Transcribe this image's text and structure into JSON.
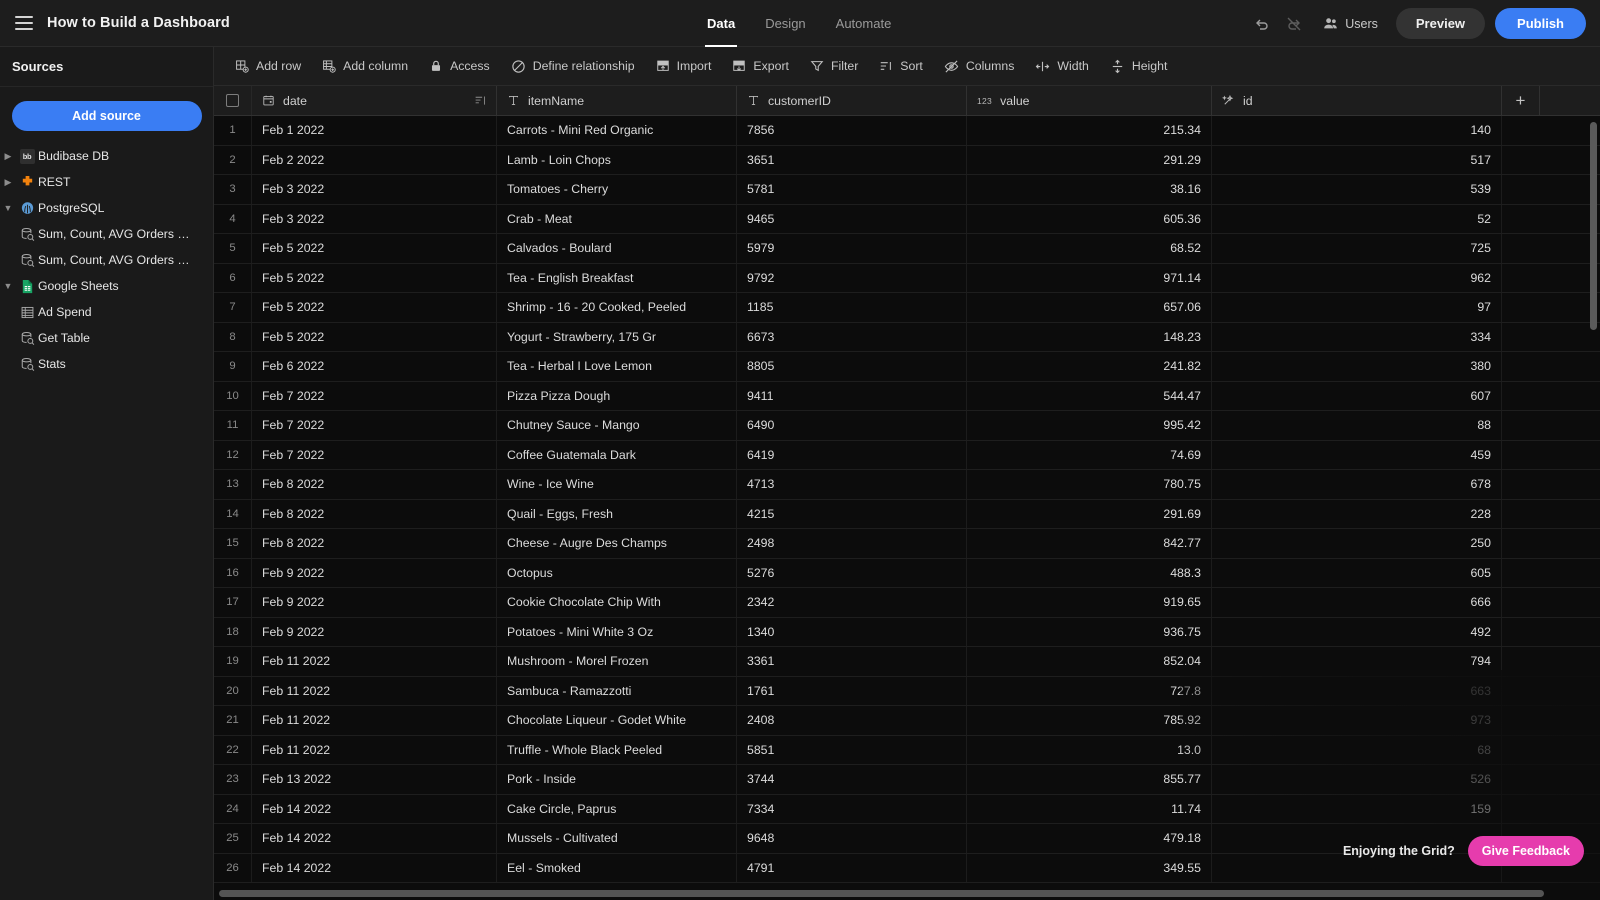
{
  "header": {
    "menu_icon": "hamburger-icon",
    "title": "How to Build a Dashboard",
    "tabs": [
      {
        "label": "Data",
        "active": true
      },
      {
        "label": "Design",
        "active": false
      },
      {
        "label": "Automate",
        "active": false
      }
    ],
    "undo_icon": "undo-icon",
    "redo_icon": "redo-icon",
    "users_icon": "users-icon",
    "users_label": "Users",
    "preview_label": "Preview",
    "publish_label": "Publish",
    "publish_color": "#3a7df3"
  },
  "sidebar": {
    "title": "Sources",
    "add_source_label": "Add source",
    "items": [
      {
        "label": "Budibase DB",
        "icon": "budibase-db-icon",
        "level": 0,
        "expanded": false,
        "chevron": "chevron-right-icon"
      },
      {
        "label": "REST",
        "icon": "rest-icon",
        "level": 0,
        "expanded": false,
        "chevron": "chevron-right-icon"
      },
      {
        "label": "PostgreSQL",
        "icon": "postgresql-icon",
        "level": 0,
        "expanded": true,
        "chevron": "chevron-down-icon"
      },
      {
        "label": "Sum, Count, AVG Orders By Date",
        "icon": "query-icon",
        "level": 1
      },
      {
        "label": "Sum, Count, AVG Orders By Dat…",
        "icon": "query-icon",
        "level": 1
      },
      {
        "label": "Google Sheets",
        "icon": "google-sheets-icon",
        "level": 0,
        "expanded": true,
        "chevron": "chevron-down-icon"
      },
      {
        "label": "Ad Spend",
        "icon": "table-icon",
        "level": 1
      },
      {
        "label": "Get Table",
        "icon": "query-icon",
        "level": 1
      },
      {
        "label": "Stats",
        "icon": "query-icon",
        "level": 1
      }
    ]
  },
  "toolbar": {
    "items": [
      {
        "label": "Add row",
        "icon": "add-row-icon"
      },
      {
        "label": "Add column",
        "icon": "add-column-icon"
      },
      {
        "label": "Access",
        "icon": "lock-icon"
      },
      {
        "label": "Define relationship",
        "icon": "relationship-icon"
      },
      {
        "label": "Import",
        "icon": "import-icon"
      },
      {
        "label": "Export",
        "icon": "export-icon"
      },
      {
        "label": "Filter",
        "icon": "filter-icon"
      },
      {
        "label": "Sort",
        "icon": "sort-icon"
      },
      {
        "label": "Columns",
        "icon": "hide-columns-icon"
      },
      {
        "label": "Width",
        "icon": "width-icon"
      },
      {
        "label": "Height",
        "icon": "height-icon"
      }
    ]
  },
  "grid": {
    "select_all_icon": "checkbox-icon",
    "add_column_icon": "plus-icon",
    "columns": [
      {
        "name": "date",
        "type_icon": "calendar-icon",
        "sorted": true,
        "sort_icon": "sort-descending-icon"
      },
      {
        "name": "itemName",
        "type_icon": "text-icon"
      },
      {
        "name": "customerID",
        "type_icon": "text-icon"
      },
      {
        "name": "value",
        "type_icon": "number-icon"
      },
      {
        "name": "id",
        "type_icon": "formula-icon"
      }
    ],
    "rows": [
      {
        "n": "1",
        "date": "Feb 1 2022",
        "itemName": "Carrots - Mini Red Organic",
        "customerID": "7856",
        "value": "215.34",
        "id": "140"
      },
      {
        "n": "2",
        "date": "Feb 2 2022",
        "itemName": "Lamb - Loin Chops",
        "customerID": "3651",
        "value": "291.29",
        "id": "517"
      },
      {
        "n": "3",
        "date": "Feb 3 2022",
        "itemName": "Tomatoes - Cherry",
        "customerID": "5781",
        "value": "38.16",
        "id": "539"
      },
      {
        "n": "4",
        "date": "Feb 3 2022",
        "itemName": "Crab - Meat",
        "customerID": "9465",
        "value": "605.36",
        "id": "52"
      },
      {
        "n": "5",
        "date": "Feb 5 2022",
        "itemName": "Calvados - Boulard",
        "customerID": "5979",
        "value": "68.52",
        "id": "725"
      },
      {
        "n": "6",
        "date": "Feb 5 2022",
        "itemName": "Tea - English Breakfast",
        "customerID": "9792",
        "value": "971.14",
        "id": "962"
      },
      {
        "n": "7",
        "date": "Feb 5 2022",
        "itemName": "Shrimp - 16 - 20 Cooked, Peeled",
        "customerID": "1185",
        "value": "657.06",
        "id": "97"
      },
      {
        "n": "8",
        "date": "Feb 5 2022",
        "itemName": "Yogurt - Strawberry, 175 Gr",
        "customerID": "6673",
        "value": "148.23",
        "id": "334"
      },
      {
        "n": "9",
        "date": "Feb 6 2022",
        "itemName": "Tea - Herbal I Love Lemon",
        "customerID": "8805",
        "value": "241.82",
        "id": "380"
      },
      {
        "n": "10",
        "date": "Feb 7 2022",
        "itemName": "Pizza Pizza Dough",
        "customerID": "9411",
        "value": "544.47",
        "id": "607"
      },
      {
        "n": "11",
        "date": "Feb 7 2022",
        "itemName": "Chutney Sauce - Mango",
        "customerID": "6490",
        "value": "995.42",
        "id": "88"
      },
      {
        "n": "12",
        "date": "Feb 7 2022",
        "itemName": "Coffee Guatemala Dark",
        "customerID": "6419",
        "value": "74.69",
        "id": "459"
      },
      {
        "n": "13",
        "date": "Feb 8 2022",
        "itemName": "Wine - Ice Wine",
        "customerID": "4713",
        "value": "780.75",
        "id": "678"
      },
      {
        "n": "14",
        "date": "Feb 8 2022",
        "itemName": "Quail - Eggs, Fresh",
        "customerID": "4215",
        "value": "291.69",
        "id": "228"
      },
      {
        "n": "15",
        "date": "Feb 8 2022",
        "itemName": "Cheese - Augre Des Champs",
        "customerID": "2498",
        "value": "842.77",
        "id": "250"
      },
      {
        "n": "16",
        "date": "Feb 9 2022",
        "itemName": "Octopus",
        "customerID": "5276",
        "value": "488.3",
        "id": "605"
      },
      {
        "n": "17",
        "date": "Feb 9 2022",
        "itemName": "Cookie Chocolate Chip With",
        "customerID": "2342",
        "value": "919.65",
        "id": "666"
      },
      {
        "n": "18",
        "date": "Feb 9 2022",
        "itemName": "Potatoes - Mini White 3 Oz",
        "customerID": "1340",
        "value": "936.75",
        "id": "492"
      },
      {
        "n": "19",
        "date": "Feb 11 2022",
        "itemName": "Mushroom - Morel Frozen",
        "customerID": "3361",
        "value": "852.04",
        "id": "794"
      },
      {
        "n": "20",
        "date": "Feb 11 2022",
        "itemName": "Sambuca - Ramazzotti",
        "customerID": "1761",
        "value": "727.8",
        "id": "663"
      },
      {
        "n": "21",
        "date": "Feb 11 2022",
        "itemName": "Chocolate Liqueur - Godet White",
        "customerID": "2408",
        "value": "785.92",
        "id": "973"
      },
      {
        "n": "22",
        "date": "Feb 11 2022",
        "itemName": "Truffle - Whole Black Peeled",
        "customerID": "5851",
        "value": "13.0",
        "id": "68"
      },
      {
        "n": "23",
        "date": "Feb 13 2022",
        "itemName": "Pork - Inside",
        "customerID": "3744",
        "value": "855.77",
        "id": "526"
      },
      {
        "n": "24",
        "date": "Feb 14 2022",
        "itemName": "Cake Circle, Paprus",
        "customerID": "7334",
        "value": "11.74",
        "id": "159"
      },
      {
        "n": "25",
        "date": "Feb 14 2022",
        "itemName": "Mussels - Cultivated",
        "customerID": "9648",
        "value": "479.18",
        "id": ""
      },
      {
        "n": "26",
        "date": "Feb 14 2022",
        "itemName": "Eel - Smoked",
        "customerID": "4791",
        "value": "349.55",
        "id": ""
      }
    ]
  },
  "feedback": {
    "label": "Enjoying the Grid?",
    "button_label": "Give Feedback",
    "button_color": "#e63cad"
  }
}
